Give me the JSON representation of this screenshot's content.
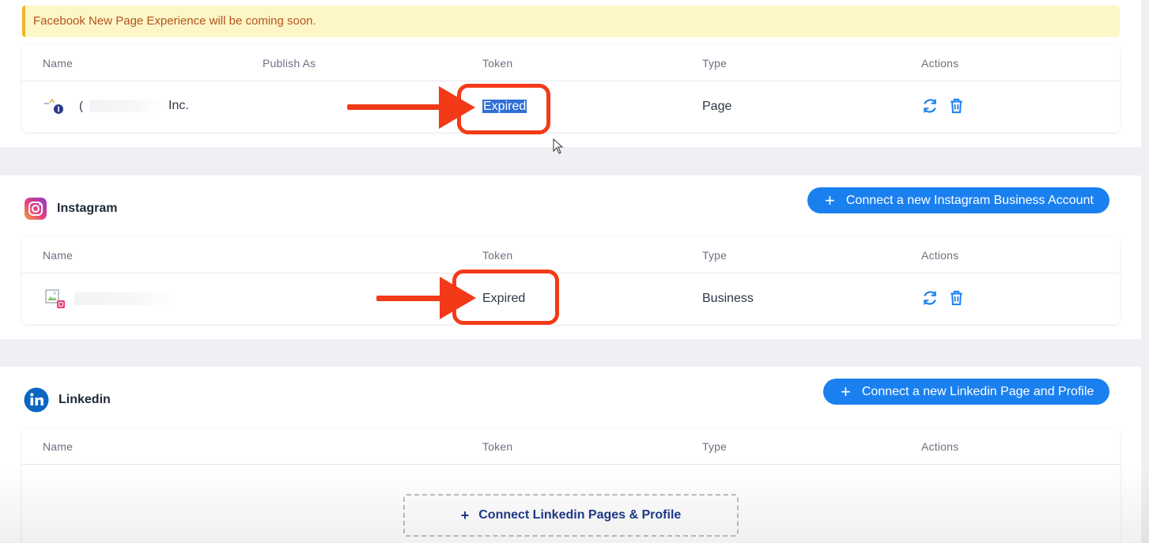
{
  "facebook": {
    "notice": "Facebook New Page Experience will be coming soon.",
    "columns": [
      "Name",
      "Publish As",
      "Token",
      "Type",
      "Actions"
    ],
    "row": {
      "name_prefix": "(",
      "name_suffix": "Inc.",
      "token": "Expired",
      "type": "Page",
      "icon": "facebook-page-avatar-icon"
    }
  },
  "instagram": {
    "title": "Instagram",
    "connect_label": "Connect a new Instagram Business Account",
    "columns": [
      "Name",
      "Token",
      "Type",
      "Actions"
    ],
    "row": {
      "token": "Expired",
      "type": "Business",
      "icon": "broken-image-icon"
    }
  },
  "linkedin": {
    "title": "Linkedin",
    "connect_label": "Connect a new Linkedin Page and Profile",
    "columns": [
      "Name",
      "Token",
      "Type",
      "Actions"
    ],
    "empty_button_label": "Connect Linkedin Pages & Profile"
  },
  "icons": {
    "refresh": "refresh-icon",
    "delete": "trash-icon",
    "plus": "plus-icon"
  },
  "colors": {
    "primary": "#1a80f0",
    "annotation": "#f33a18",
    "notice_bg": "#fdf6c7",
    "notice_text": "#b4531f",
    "selection": "#2f6fd6"
  }
}
